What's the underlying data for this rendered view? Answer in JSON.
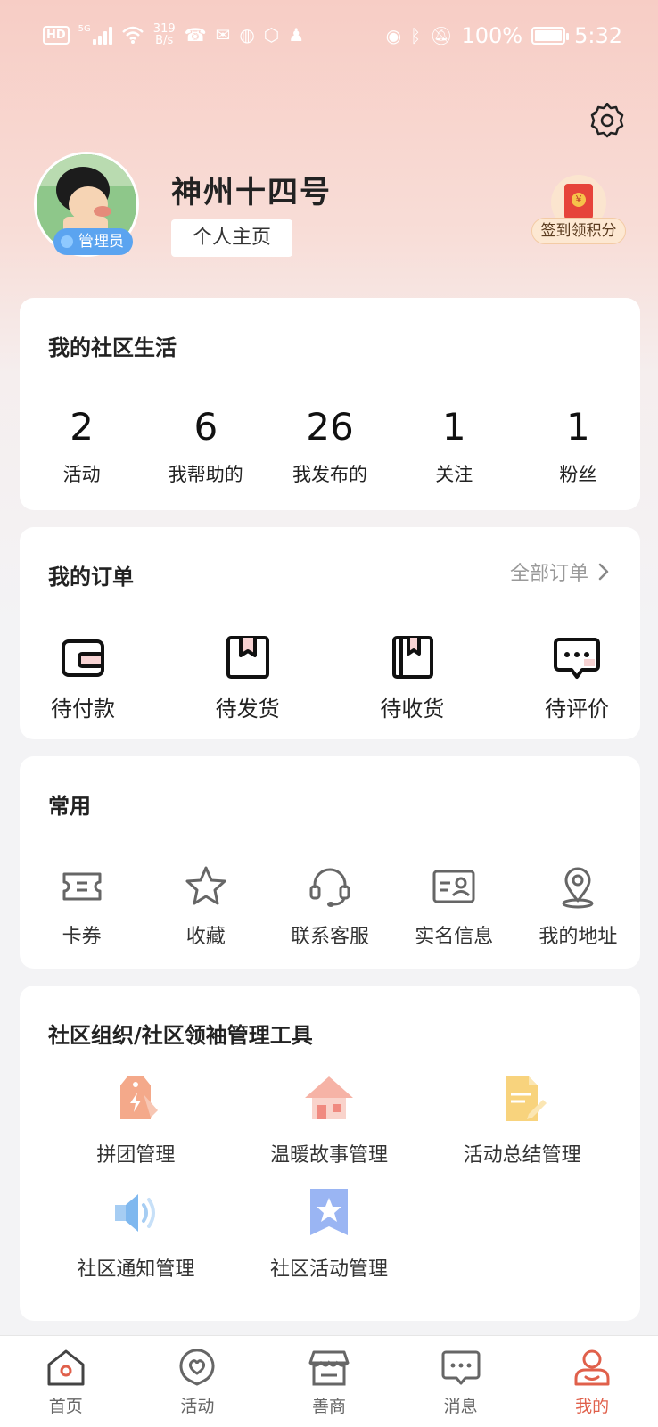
{
  "status_bar": {
    "network_speed_value": "319",
    "network_speed_unit": "B/s",
    "network_type": "5G",
    "battery_percent": "100%",
    "time": "5:32"
  },
  "profile": {
    "username": "神州十四号",
    "role_badge": "管理员",
    "homepage_button": "个人主页",
    "signin_label": "签到领积分"
  },
  "community": {
    "title": "我的社区生活",
    "stats": [
      {
        "value": "2",
        "label": "活动"
      },
      {
        "value": "6",
        "label": "我帮助的"
      },
      {
        "value": "26",
        "label": "我发布的"
      },
      {
        "value": "1",
        "label": "关注"
      },
      {
        "value": "1",
        "label": "粉丝"
      }
    ]
  },
  "orders": {
    "title": "我的订单",
    "all_link": "全部订单",
    "items": [
      {
        "label": "待付款",
        "icon": "wallet-icon"
      },
      {
        "label": "待发货",
        "icon": "box-icon"
      },
      {
        "label": "待收货",
        "icon": "book-icon"
      },
      {
        "label": "待评价",
        "icon": "comment-icon"
      }
    ]
  },
  "common": {
    "title": "常用",
    "items": [
      {
        "label": "卡券",
        "icon": "coupon-icon"
      },
      {
        "label": "收藏",
        "icon": "star-icon"
      },
      {
        "label": "联系客服",
        "icon": "headset-icon"
      },
      {
        "label": "实名信息",
        "icon": "id-card-icon"
      },
      {
        "label": "我的地址",
        "icon": "location-icon"
      }
    ]
  },
  "tools": {
    "title": "社区组织/社区领袖管理工具",
    "items": [
      {
        "label": "拼团管理",
        "icon": "tag-icon",
        "color": "#f08a5d"
      },
      {
        "label": "温暖故事管理",
        "icon": "house-icon",
        "color": "#f08a80"
      },
      {
        "label": "活动总结管理",
        "icon": "document-icon",
        "color": "#f6c35b"
      },
      {
        "label": "社区通知管理",
        "icon": "speaker-icon",
        "color": "#7fb8ef"
      },
      {
        "label": "社区活动管理",
        "icon": "star-bookmark-icon",
        "color": "#7f9ef0"
      }
    ]
  },
  "bottom_nav": {
    "items": [
      {
        "label": "首页",
        "icon": "home-icon"
      },
      {
        "label": "活动",
        "icon": "activity-heart-icon"
      },
      {
        "label": "善商",
        "icon": "shop-icon"
      },
      {
        "label": "消息",
        "icon": "message-icon"
      },
      {
        "label": "我的",
        "icon": "profile-icon"
      }
    ],
    "active_index": 4,
    "active_color": "#e0604b"
  }
}
